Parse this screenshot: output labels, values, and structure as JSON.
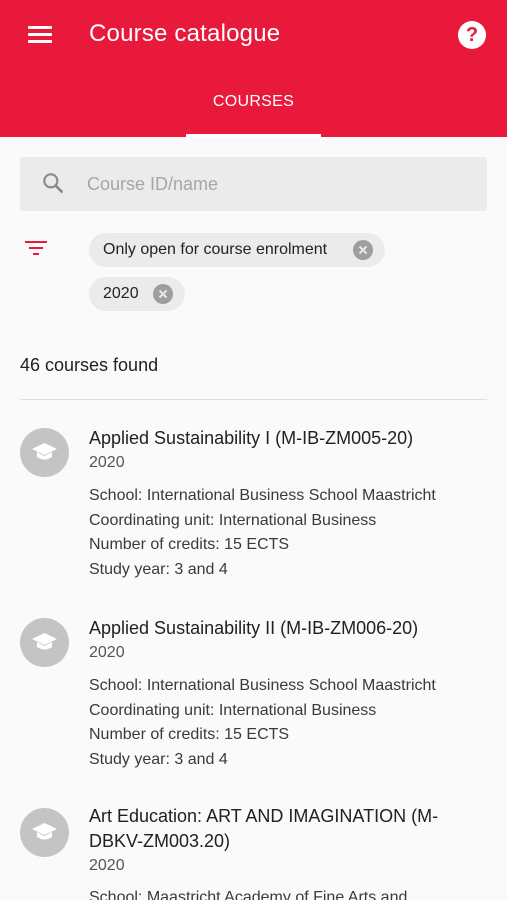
{
  "app_bar": {
    "title": "Course catalogue",
    "help_symbol": "?",
    "menu_icon": "hamburger-menu-icon",
    "help_icon": "help-circle-icon",
    "color": "#e8193a"
  },
  "tabs": [
    {
      "label": "COURSES",
      "active": true
    }
  ],
  "search": {
    "placeholder": "Course ID/name",
    "value": "",
    "icon": "search-icon"
  },
  "filters": {
    "icon": "filter-icon",
    "chips": [
      {
        "label": "Only open for course enrolment"
      },
      {
        "label": "2020"
      }
    ]
  },
  "results": {
    "count_text": "46 courses found"
  },
  "courses": [
    {
      "title": "Applied Sustainability I (M-IB-ZM005-20)",
      "year": "2020",
      "school": "School: International Business School Maastricht",
      "unit": "Coordinating unit: International Business",
      "credits": "Number of credits: 15 ECTS",
      "study_year": "Study year: 3 and 4",
      "icon": "graduation-cap-icon"
    },
    {
      "title": "Applied Sustainability II (M-IB-ZM006-20)",
      "year": "2020",
      "school": "School: International Business School Maastricht",
      "unit": "Coordinating unit: International Business",
      "credits": "Number of credits: 15 ECTS",
      "study_year": "Study year: 3 and 4",
      "icon": "graduation-cap-icon"
    },
    {
      "title": "Art Education: ART AND IMAGINATION (M-DBKV-ZM003.20)",
      "year": "2020",
      "school": "School: Maastricht Academy of Fine Arts and",
      "icon": "graduation-cap-icon"
    }
  ]
}
